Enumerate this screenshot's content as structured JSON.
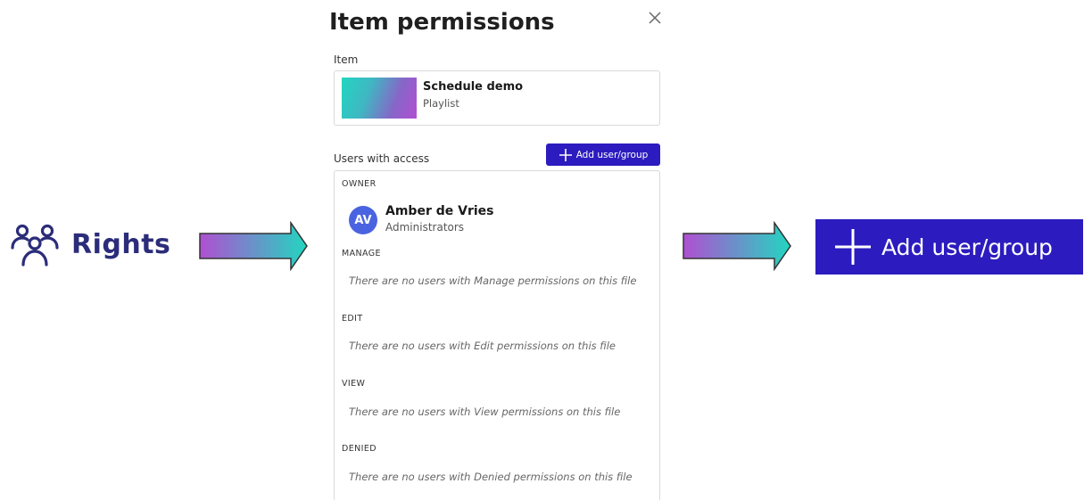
{
  "rights": {
    "icon": "users-icon",
    "label": "Rights"
  },
  "dialog": {
    "title": "Item permissions",
    "close_icon": "close-icon",
    "item": {
      "section_label": "Item",
      "name": "Schedule demo",
      "type": "Playlist"
    },
    "users": {
      "section_label": "Users with access",
      "add_button_label": "Add user/group",
      "groups": {
        "owner": {
          "title": "OWNER",
          "avatar_initials": "AV",
          "name": "Amber de Vries",
          "role": "Administrators"
        },
        "manage": {
          "title": "MANAGE",
          "empty": "There are no users with Manage permissions on this file"
        },
        "edit": {
          "title": "EDIT",
          "empty": "There are no users with Edit permissions on this file"
        },
        "view": {
          "title": "VIEW",
          "empty": "There are no users with View permissions on this file"
        },
        "denied": {
          "title": "DENIED",
          "empty": "There are no users with Denied permissions on this file"
        }
      }
    }
  },
  "callout": {
    "add_button_label": "Add user/group"
  },
  "colors": {
    "accent": "#2c1cbf",
    "rights_text": "#2b2d7a",
    "avatar": "#4a63e0",
    "arrow_gradient_start": "#b04fd2",
    "arrow_gradient_end": "#22d6c0"
  }
}
